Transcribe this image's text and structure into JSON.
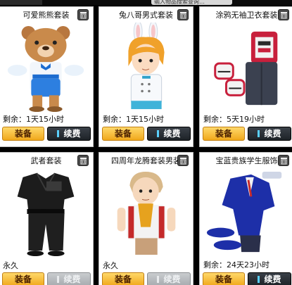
{
  "topbar": {
    "left_text": "",
    "search_text": "输入物品搜索查询…"
  },
  "items": [
    {
      "name": "可爱熊熊套装",
      "remaining_label": "剩余：",
      "remaining": "1天15小时",
      "equip": "装备",
      "renew": "续费",
      "renew_enabled": true
    },
    {
      "name": "兔八哥男式套装",
      "remaining_label": "剩余：",
      "remaining": "1天15小时",
      "equip": "装备",
      "renew": "续费",
      "renew_enabled": true
    },
    {
      "name": "涂鸦无袖卫衣套装",
      "remaining_label": "剩余：",
      "remaining": "5天19小时",
      "equip": "装备",
      "renew": "续费",
      "renew_enabled": true
    },
    {
      "name": "武者套装",
      "remaining_label": "",
      "remaining": "永久",
      "equip": "装备",
      "renew": "续费",
      "renew_enabled": false
    },
    {
      "name": "四周年龙腾套装男装",
      "remaining_label": "",
      "remaining": "永久",
      "equip": "装备",
      "renew": "续费",
      "renew_enabled": false
    },
    {
      "name": "宝蓝贵族学生服饰",
      "remaining_label": "剩余：",
      "remaining": "24天23小时",
      "equip": "装备",
      "renew": "续费",
      "renew_enabled": true
    }
  ],
  "colors": {
    "equip_button": "#f0a81c",
    "renew_button": "#1e2328",
    "renew_accent": "#5ad0ff",
    "card_bg": "#ffffff",
    "page_bg": "#000000"
  },
  "icons": {
    "delete": "trash-icon"
  }
}
